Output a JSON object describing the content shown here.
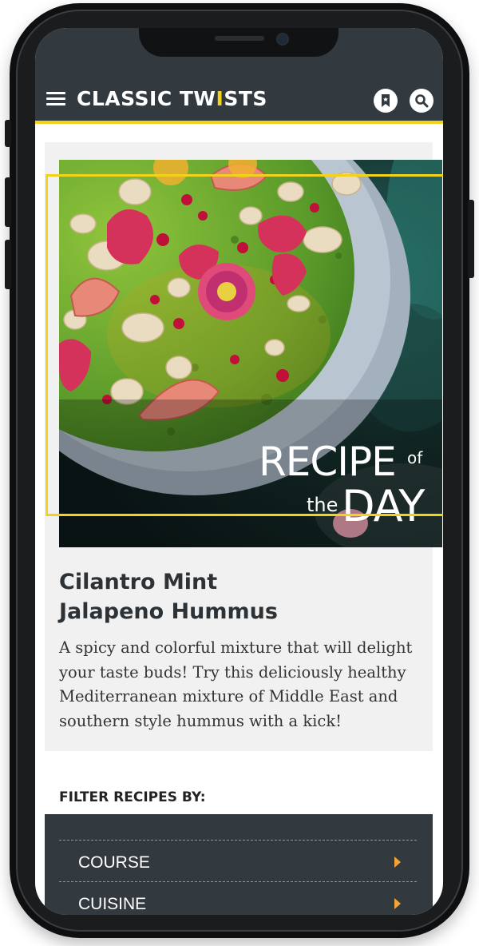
{
  "header": {
    "brand_left": "CLASSIC TW",
    "brand_fork": "I",
    "brand_right": "STS",
    "brand_color": "#323a3f",
    "accent_color": "#f2d21c",
    "menu_icon": "hamburger-menu-icon",
    "bookmark_icon": "bookmark-icon",
    "search_icon": "search-icon"
  },
  "hero": {
    "overlay_word1": "RECIPE",
    "overlay_of": "of",
    "overlay_the": "the",
    "overlay_word2": "DAY"
  },
  "recipe": {
    "title_line1": "Cilantro Mint",
    "title_line2": "Jalapeno Hummus",
    "description": "A spicy and colorful mixture that will delight your taste buds! Try this deliciously healthy Mediterranean mixture of Middle East and southern style hummus with a kick!"
  },
  "filters": {
    "heading": "FILTER RECIPES BY:",
    "arrow_color": "#f0a43a",
    "items": [
      {
        "label": "COURSE"
      },
      {
        "label": "CUISINE"
      }
    ]
  }
}
